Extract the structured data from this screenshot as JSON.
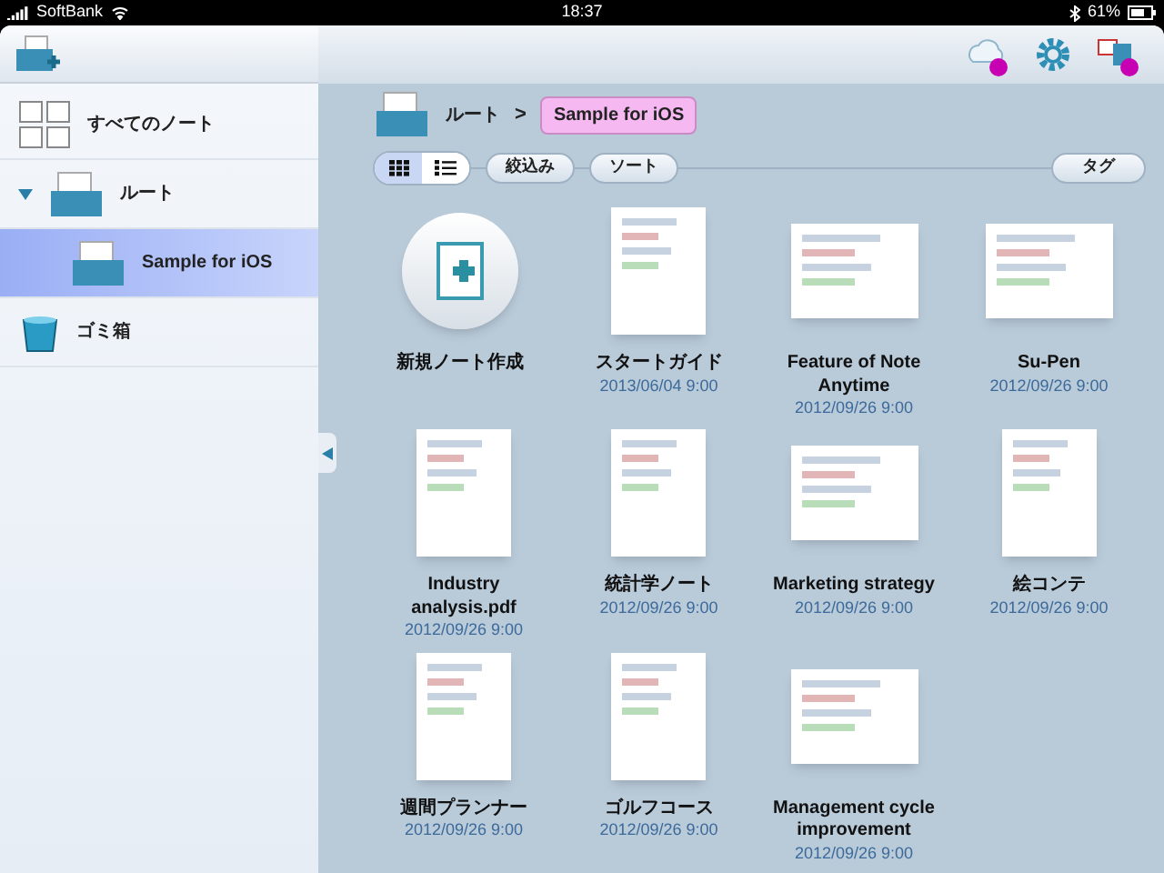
{
  "status_bar": {
    "carrier": "SoftBank",
    "time": "18:37",
    "battery": "61%"
  },
  "sidebar": {
    "items": [
      {
        "kind": "all",
        "label": "すべてのノート",
        "selected": false
      },
      {
        "kind": "folder",
        "label": "ルート",
        "selected": false,
        "expanded": true,
        "children": [
          {
            "kind": "folder",
            "label": "Sample for iOS",
            "selected": true
          }
        ]
      },
      {
        "kind": "trash",
        "label": "ゴミ箱",
        "selected": false
      }
    ]
  },
  "breadcrumb": {
    "items": [
      {
        "label": "ルート",
        "selected": false
      },
      {
        "label": "Sample for iOS",
        "selected": true
      }
    ],
    "separator": ">"
  },
  "toolbar": {
    "views": [
      {
        "kind": "grid",
        "selected": true
      },
      {
        "kind": "list",
        "selected": false
      }
    ],
    "buttons": [
      "絞込み",
      "ソート"
    ],
    "tag_button": "タグ"
  },
  "notes": [
    {
      "kind": "new",
      "title": "新規ノート作成"
    },
    {
      "kind": "portrait",
      "title": "スタートガイド",
      "date": "2013/06/04 9:00"
    },
    {
      "kind": "landscape",
      "title": "Feature of Note Anytime",
      "date": "2012/09/26 9:00"
    },
    {
      "kind": "landscape",
      "title": "Su-Pen",
      "date": "2012/09/26 9:00"
    },
    {
      "kind": "portrait",
      "title": "Industry analysis.pdf",
      "date": "2012/09/26 9:00"
    },
    {
      "kind": "portrait",
      "title": "統計学ノート",
      "date": "2012/09/26 9:00"
    },
    {
      "kind": "landscape",
      "title": "Marketing strategy",
      "date": "2012/09/26 9:00"
    },
    {
      "kind": "portrait",
      "title": "絵コンテ",
      "date": "2012/09/26 9:00"
    },
    {
      "kind": "portrait",
      "title": "週間プランナー",
      "date": "2012/09/26 9:00"
    },
    {
      "kind": "portrait",
      "title": "ゴルフコース",
      "date": "2012/09/26 9:00"
    },
    {
      "kind": "landscape",
      "title": "Management cycle improvement",
      "date": "2012/09/26 9:00"
    }
  ]
}
